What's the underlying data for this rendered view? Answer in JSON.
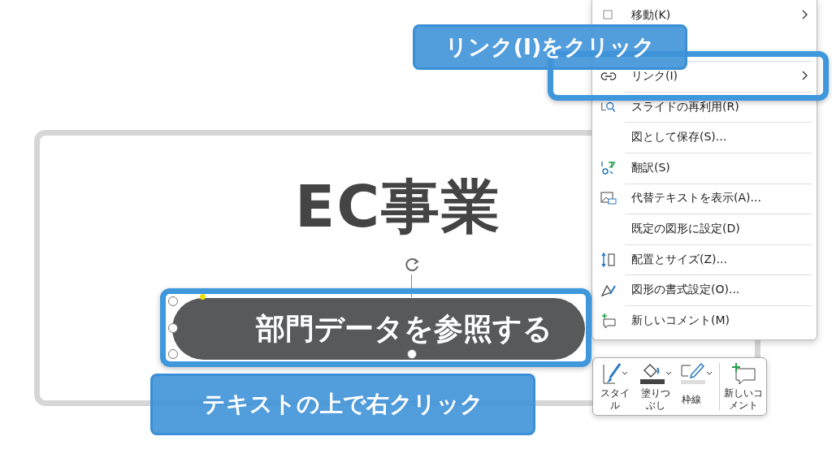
{
  "slide": {
    "title": "EC事業",
    "button_label": "部門データを参照する"
  },
  "context_menu": {
    "items": [
      {
        "label": "移動(K)",
        "submenu": true
      },
      {
        "label": "リンク(I)",
        "submenu": true
      },
      {
        "label": "スライドの再利用(R)",
        "submenu": false
      },
      {
        "label": "図として保存(S)...",
        "submenu": false
      },
      {
        "label": "翻訳(S)",
        "submenu": false
      },
      {
        "label": "代替テキストを表示(A)...",
        "submenu": false
      },
      {
        "label": "既定の図形に設定(D)",
        "submenu": false
      },
      {
        "label": "配置とサイズ(Z)...",
        "submenu": false
      },
      {
        "label": "図形の書式設定(O)...",
        "submenu": false
      },
      {
        "label": "新しいコメント(M)",
        "submenu": false
      }
    ]
  },
  "mini_toolbar": {
    "buttons": [
      {
        "label": "スタイル",
        "dropdown": true
      },
      {
        "label": "塗りつぶし",
        "dropdown": true
      },
      {
        "label": "枠線",
        "dropdown": true
      },
      {
        "label": "新しいコメント",
        "dropdown": false
      }
    ]
  },
  "callouts": [
    {
      "text": "リンク(I)をクリック"
    },
    {
      "text": "テキストの上で右クリック"
    }
  ]
}
